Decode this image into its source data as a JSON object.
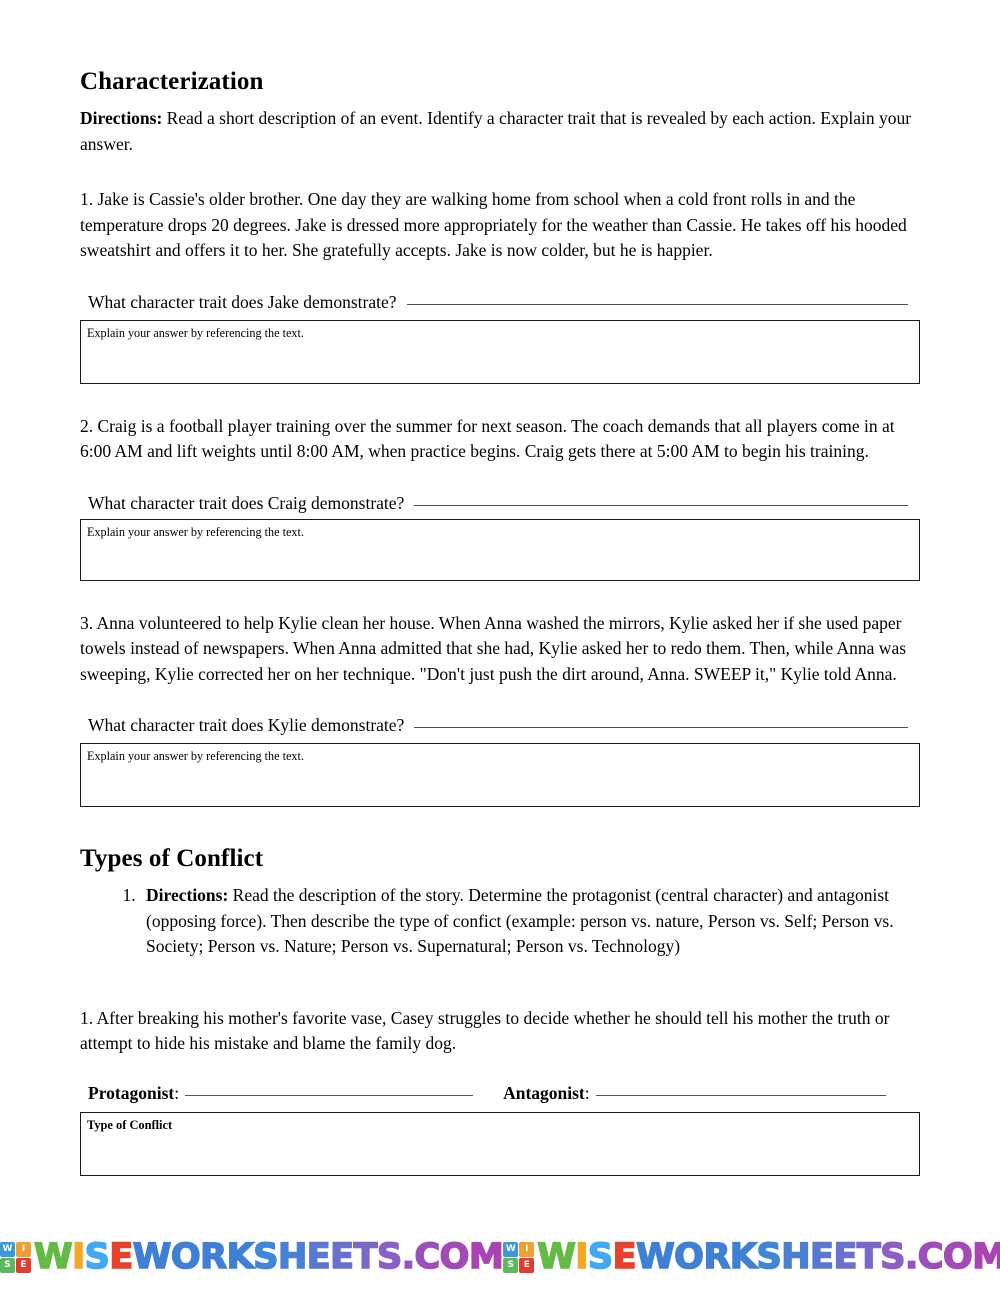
{
  "document": {
    "sections": [
      {
        "title": "Characterization",
        "directions_prefix": "Directions:",
        "directions_text": " Read a short description of an event.  Identify a character trait that is revealed by each action.  Explain your answer.",
        "items": [
          {
            "passage": "1. Jake is Cassie's older brother.  One day they are walking home from school when a cold front rolls in and the temperature drops 20 degrees.  Jake is dressed more appropriately for the weather than Cassie.  He takes off his hooded sweatshirt and offers it to her.  She gratefully accepts. Jake is now colder, but he is happier.",
            "question": "What character trait does Jake demonstrate?",
            "box_hint": "Explain your answer by referencing the text."
          },
          {
            "passage": "2.  Craig is a football player training over the summer for next season.  The coach demands that all players come in at 6:00 AM and lift weights until 8:00 AM, when practice begins.  Craig gets there at 5:00 AM to begin his training.",
            "question": "What character trait does Craig demonstrate?",
            "box_hint": "Explain your answer by referencing the text."
          },
          {
            "passage": "3. Anna volunteered to help Kylie clean her house.  When Anna washed the mirrors, Kylie asked her if she used paper towels instead of newspapers.  When Anna admitted that she had, Kylie asked her to redo them.  Then, while Anna was sweeping, Kylie corrected her on her technique.  \"Don't just push the dirt around, Anna.  SWEEP it,\" Kylie told Anna.",
            "question": "What character trait does Kylie demonstrate?",
            "box_hint": "Explain your answer by referencing the text."
          }
        ]
      },
      {
        "title": "Types of Conflict",
        "directions_prefix": "Directions:",
        "directions_text": " Read the description of the story. Determine the protagonist (central character) and antagonist (opposing force). Then describe the type of confict (example: person vs. nature, Person vs. Self; Person vs. Society; Person vs. Nature; Person vs. Supernatural; Person vs. Technology)",
        "items": [
          {
            "passage": "1. After breaking his mother's favorite vase, Casey struggles to decide whether he should tell his mother the truth or attempt to hide his mistake and blame the family dog.",
            "protagonist_label": "Protagonist",
            "antagonist_label": "Antagonist",
            "label_colon": ":",
            "box_hint": "Type of Conflict"
          }
        ]
      }
    ]
  },
  "watermark": {
    "badge_letters": [
      "W",
      "I",
      "S",
      "E"
    ],
    "badge_colors": [
      "#3b9ad6",
      "#f0a030",
      "#5cb85c",
      "#e03c31"
    ],
    "text": "WISEWORKSHEETS.COM",
    "letters": [
      {
        "ch": "W",
        "color": "#63bb46"
      },
      {
        "ch": "I",
        "color": "#f5a623"
      },
      {
        "ch": "S",
        "color": "#3fa9f5"
      },
      {
        "ch": "E",
        "color": "#e8402a"
      },
      {
        "ch": "W",
        "color": "#3f7fd4"
      },
      {
        "ch": "O",
        "color": "#3f7fd4"
      },
      {
        "ch": "R",
        "color": "#3f7fd4"
      },
      {
        "ch": "K",
        "color": "#3f7fd4"
      },
      {
        "ch": "S",
        "color": "#3f86d8"
      },
      {
        "ch": "H",
        "color": "#4a7fd6"
      },
      {
        "ch": "E",
        "color": "#5a78d2"
      },
      {
        "ch": "E",
        "color": "#6a70ce"
      },
      {
        "ch": "T",
        "color": "#7a68c9"
      },
      {
        "ch": "S",
        "color": "#8a60c4"
      },
      {
        "ch": ".",
        "color": "#9455bf"
      },
      {
        "ch": "C",
        "color": "#9b4fbc"
      },
      {
        "ch": "O",
        "color": "#a349b8"
      },
      {
        "ch": "M",
        "color": "#ab43b4"
      }
    ]
  }
}
